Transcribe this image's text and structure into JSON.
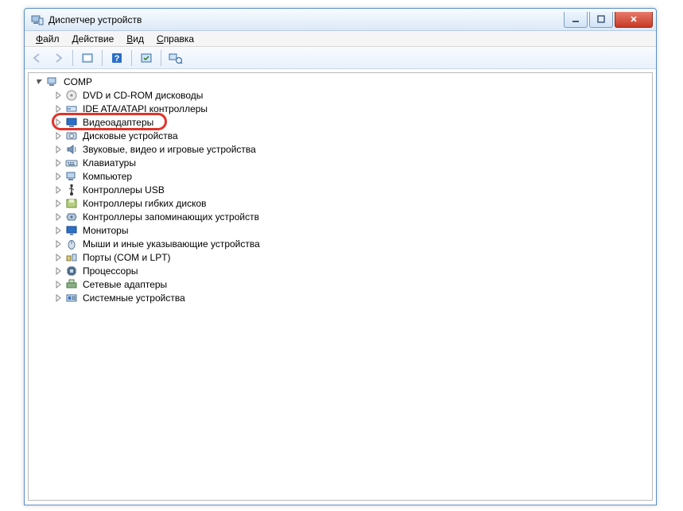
{
  "window": {
    "title": "Диспетчер устройств"
  },
  "menu": {
    "file": {
      "label": "Файл",
      "underlineIndex": 0
    },
    "action": {
      "label": "Действие",
      "underlineIndex": 0
    },
    "view": {
      "label": "Вид",
      "underlineIndex": 0
    },
    "help": {
      "label": "Справка",
      "underlineIndex": 0
    }
  },
  "toolbar": {
    "back": "back",
    "forward": "forward",
    "showHidden": "show-hidden",
    "help": "help",
    "refresh": "refresh",
    "scan": "scan"
  },
  "tree": {
    "root": {
      "label": "COMP",
      "icon": "computer"
    },
    "items": [
      {
        "label": "DVD и CD-ROM дисководы",
        "icon": "cdrom"
      },
      {
        "label": "IDE ATA/ATAPI контроллеры",
        "icon": "ide"
      },
      {
        "label": "Видеоадаптеры",
        "icon": "display",
        "highlighted": true
      },
      {
        "label": "Дисковые устройства",
        "icon": "disk"
      },
      {
        "label": "Звуковые, видео и игровые устройства",
        "icon": "sound"
      },
      {
        "label": "Клавиатуры",
        "icon": "keyboard"
      },
      {
        "label": "Компьютер",
        "icon": "computer"
      },
      {
        "label": "Контроллеры USB",
        "icon": "usb"
      },
      {
        "label": "Контроллеры гибких дисков",
        "icon": "floppyctrl"
      },
      {
        "label": "Контроллеры запоминающих устройств",
        "icon": "storage"
      },
      {
        "label": "Мониторы",
        "icon": "monitor"
      },
      {
        "label": "Мыши и иные указывающие устройства",
        "icon": "mouse"
      },
      {
        "label": "Порты (COM и LPT)",
        "icon": "ports"
      },
      {
        "label": "Процессоры",
        "icon": "cpu"
      },
      {
        "label": "Сетевые адаптеры",
        "icon": "network"
      },
      {
        "label": "Системные устройства",
        "icon": "system"
      }
    ]
  }
}
